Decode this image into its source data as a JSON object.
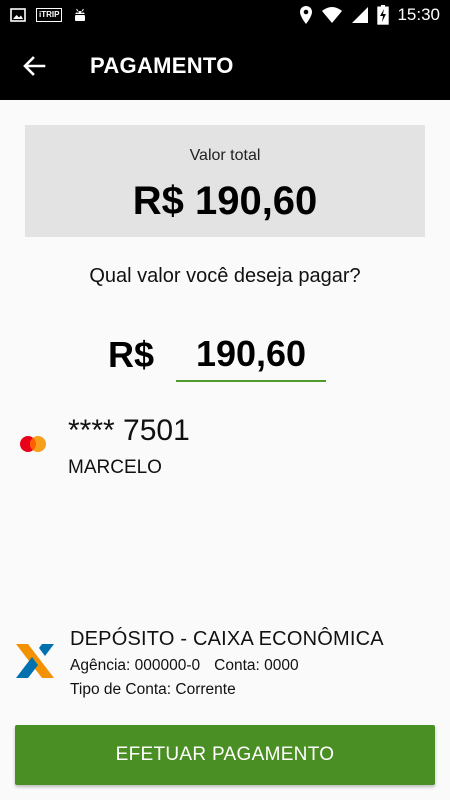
{
  "status_bar": {
    "time": "15:30",
    "left_icons": [
      "image-icon",
      "itrip-icon",
      "android-icon"
    ],
    "itrip_label": "iTRIP",
    "right_icons": [
      "location-icon",
      "wifi-icon",
      "signal-icon",
      "battery-charging-icon"
    ]
  },
  "app_bar": {
    "title": "PAGAMENTO",
    "back_icon": "arrow-left-icon"
  },
  "total": {
    "label": "Valor total",
    "value": "R$ 190,60"
  },
  "payment": {
    "question": "Qual valor você deseja pagar?",
    "currency": "R$",
    "amount": "190,60"
  },
  "card": {
    "brand_icon": "mastercard-icon",
    "number": "**** 7501",
    "holder": "MARCELO"
  },
  "deposit": {
    "bank_icon": "caixa-icon",
    "title": "DEPÓSITO - CAIXA ECONÔMICA",
    "agencia": "Agência: 000000-0",
    "conta": "Conta: 0000",
    "tipo": "Tipo de Conta: Corrente"
  },
  "action": {
    "pay_label": "EFETUAR PAGAMENTO",
    "accent_color": "#4a8f23",
    "underline_color": "#4f9a2a"
  }
}
